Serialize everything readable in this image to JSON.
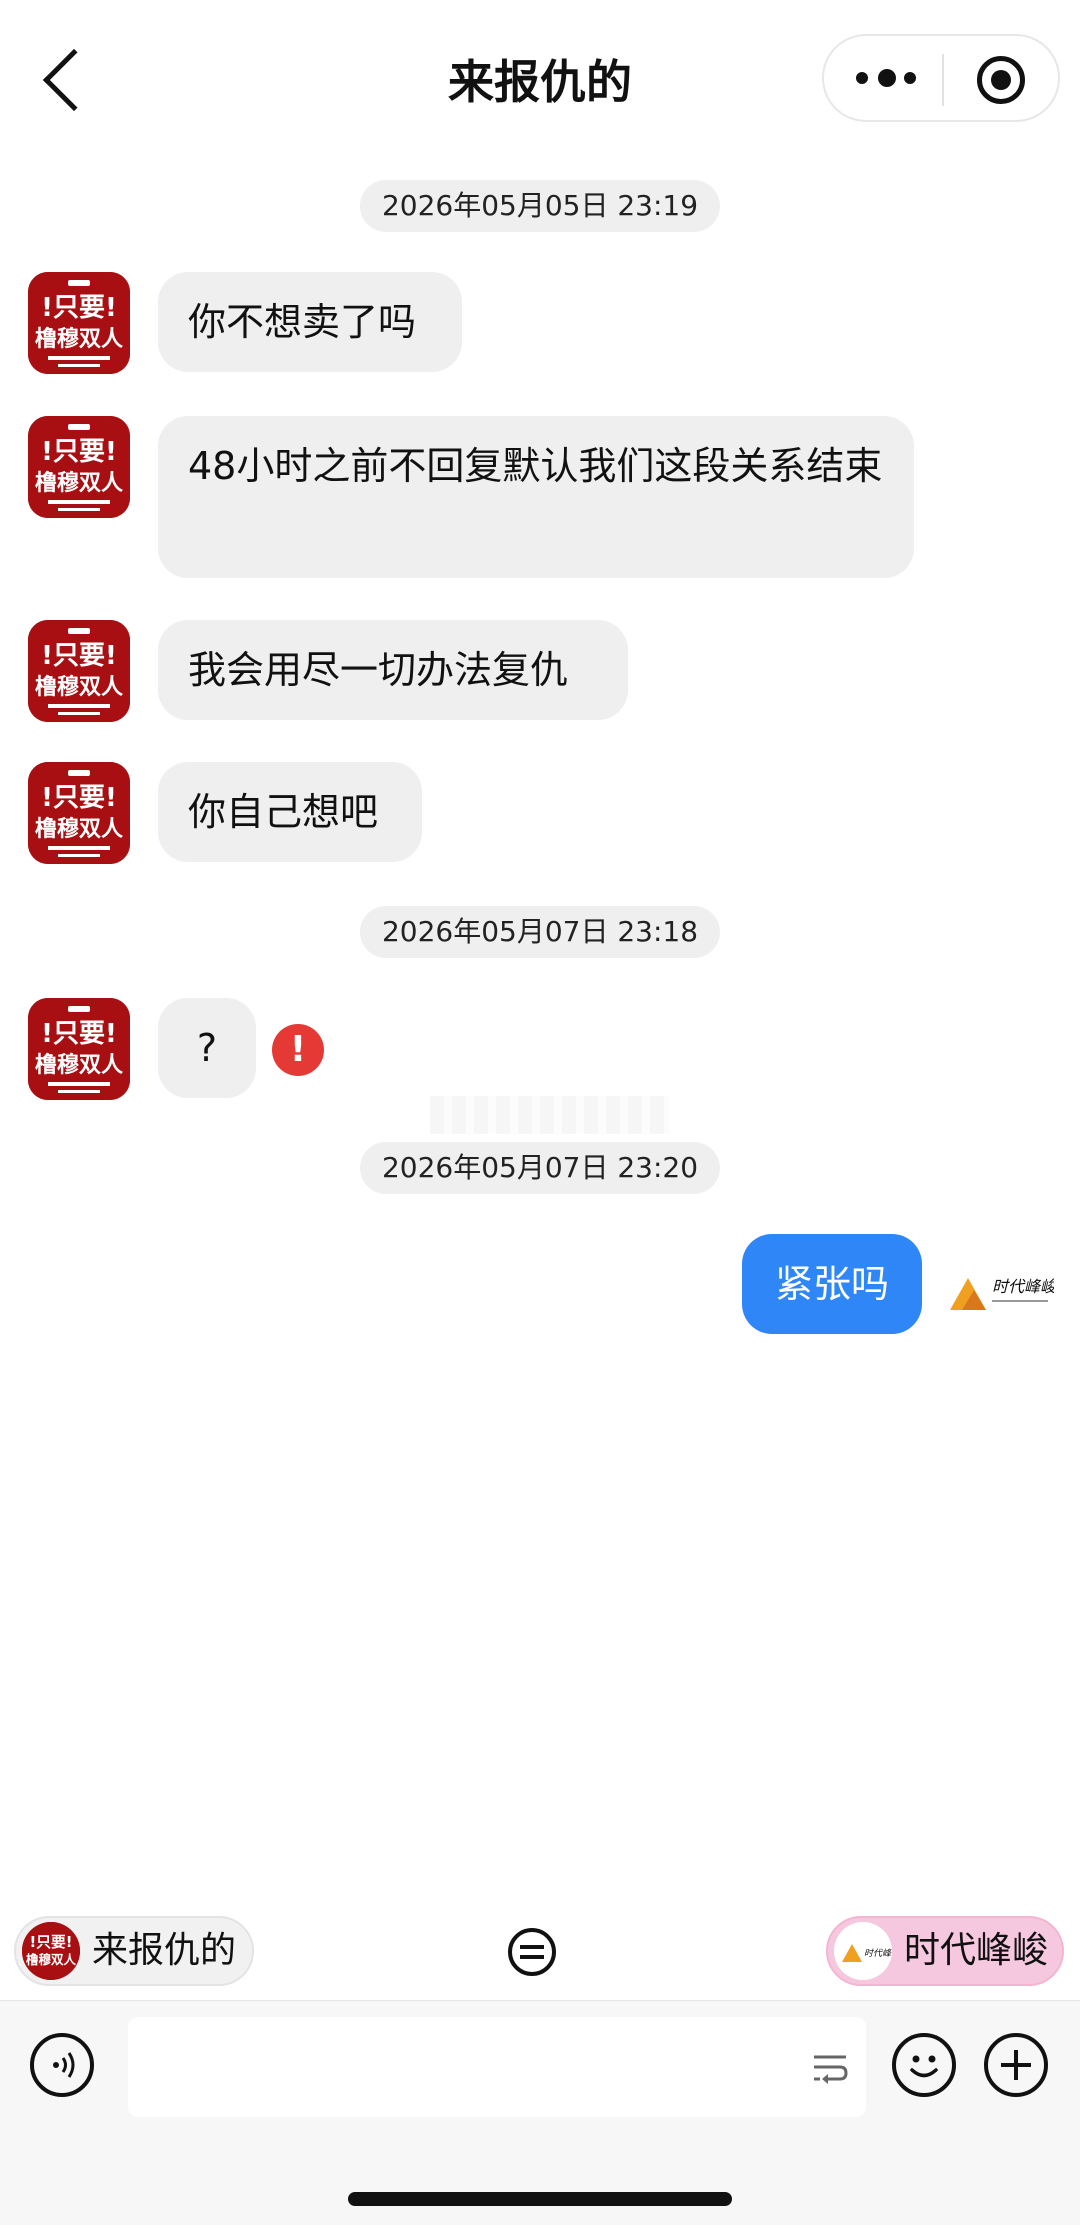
{
  "header": {
    "title": "来报仇的",
    "back_icon": "chevron-left-icon",
    "more_icon": "more-dots-icon",
    "close_icon": "target-icon"
  },
  "messages": {
    "ts1": "2026年05月05日 23:19",
    "m1": "你不想卖了吗",
    "m2": "48小时之前不回复默认我们这段关系结束",
    "m3": "我会用尽一切办法复仇",
    "m4": "你自己想吧",
    "ts2": "2026年05月07日 23:18",
    "m5": "?",
    "error_icon": "exclamation-icon",
    "error_mark": "!",
    "ts3": "2026年05月07日 23:20",
    "m6": "紧张吗"
  },
  "avatar": {
    "top_text": "!只要!",
    "bottom_text": "橹穆双人"
  },
  "me_avatar": {
    "text": "时代峰峻"
  },
  "switcher": {
    "left_label": "来报仇的",
    "right_label": "时代峰峻",
    "swap_icon": "swap-icon"
  },
  "inputbar": {
    "voice_icon": "voice-icon",
    "wrap_icon": "wrap-icon",
    "emoji_icon": "emoji-icon",
    "plus_icon": "plus-icon"
  },
  "colors": {
    "my_bubble": "#2f86f6",
    "their_bubble": "#efefef",
    "error": "#e53935",
    "avatar_red": "#a80f12",
    "right_chip": "#f6c8df"
  }
}
